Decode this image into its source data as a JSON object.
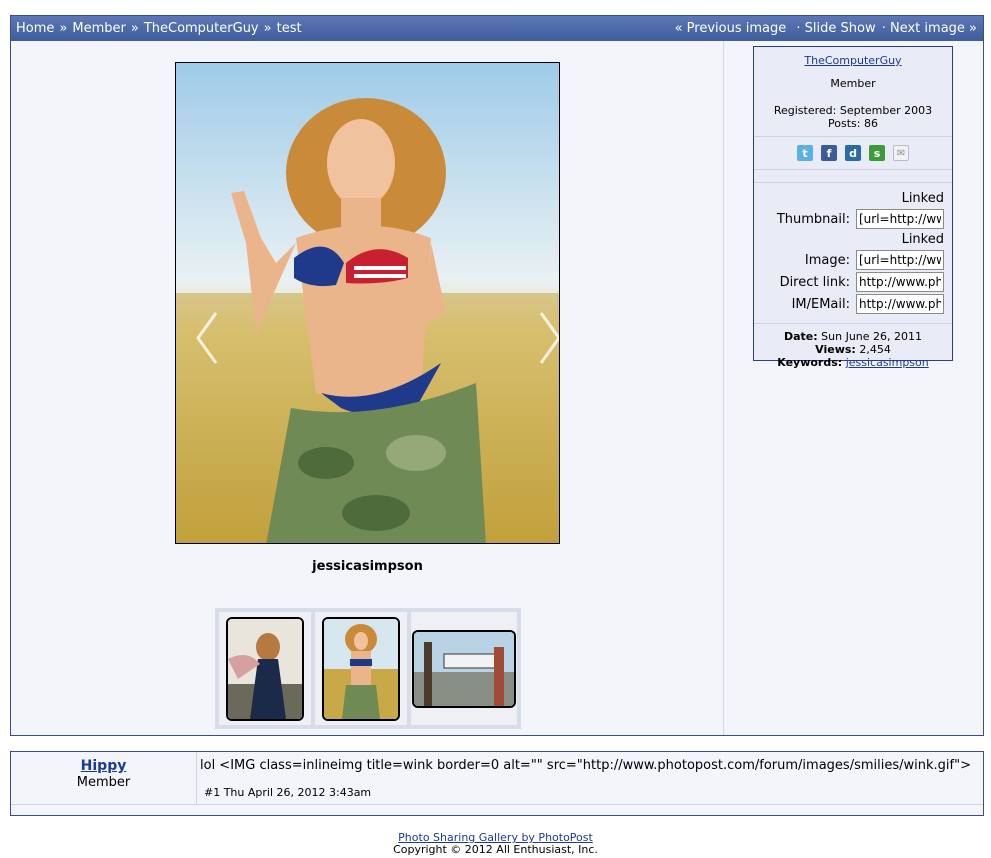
{
  "navbar": {
    "crumbs": [
      "Home",
      "Member",
      "TheComputerGuy",
      "test"
    ],
    "separator": "»",
    "prev": "« Previous image",
    "slideshow": "· Slide Show",
    "next": "· Next image »"
  },
  "image": {
    "caption": "jessicasimpson",
    "thumbnails": [
      "thumb-1",
      "thumb-2",
      "thumb-3"
    ]
  },
  "info": {
    "username": "TheComputerGuy",
    "role": "Member",
    "registered": "Registered: September 2003",
    "posts": "Posts: 86",
    "share_icons": [
      "twitter-icon",
      "facebook-icon",
      "digg-icon",
      "stumbleupon-icon",
      "email-icon"
    ],
    "share_colors": [
      "#5ab1e3",
      "#3b5b9a",
      "#2c6aa5",
      "#3d9c3a",
      "#cfd3da"
    ],
    "links": {
      "linked1": "Linked",
      "thumbnail_label": "Thumbnail:",
      "thumbnail_value": "[url=http://www",
      "linked2": "Linked",
      "image_label": "Image:",
      "image_value": "[url=http://www",
      "direct_label": "Direct link:",
      "direct_value": "http://www.pho",
      "im_label": "IM/EMail:",
      "im_value": "http://www.pho"
    },
    "date_label": "Date:",
    "date_value": "Sun June 26, 2011",
    "views_label": "Views:",
    "views_value": "2,454",
    "keywords_label": "Keywords:",
    "keywords_value": "jessicasimpson"
  },
  "comment": {
    "user": "Hippy",
    "role": "Member",
    "text": "lol <IMG class=inlineimg title=wink border=0 alt=\"\" src=\"http://www.photopost.com/forum/images/smilies/wink.gif\">",
    "stamp": "#1 Thu April 26, 2012 3:43am"
  },
  "footer": {
    "link": "Photo Sharing Gallery by PhotoPost",
    "copyright": "Copyright © 2012 All Enthusiast, Inc."
  }
}
